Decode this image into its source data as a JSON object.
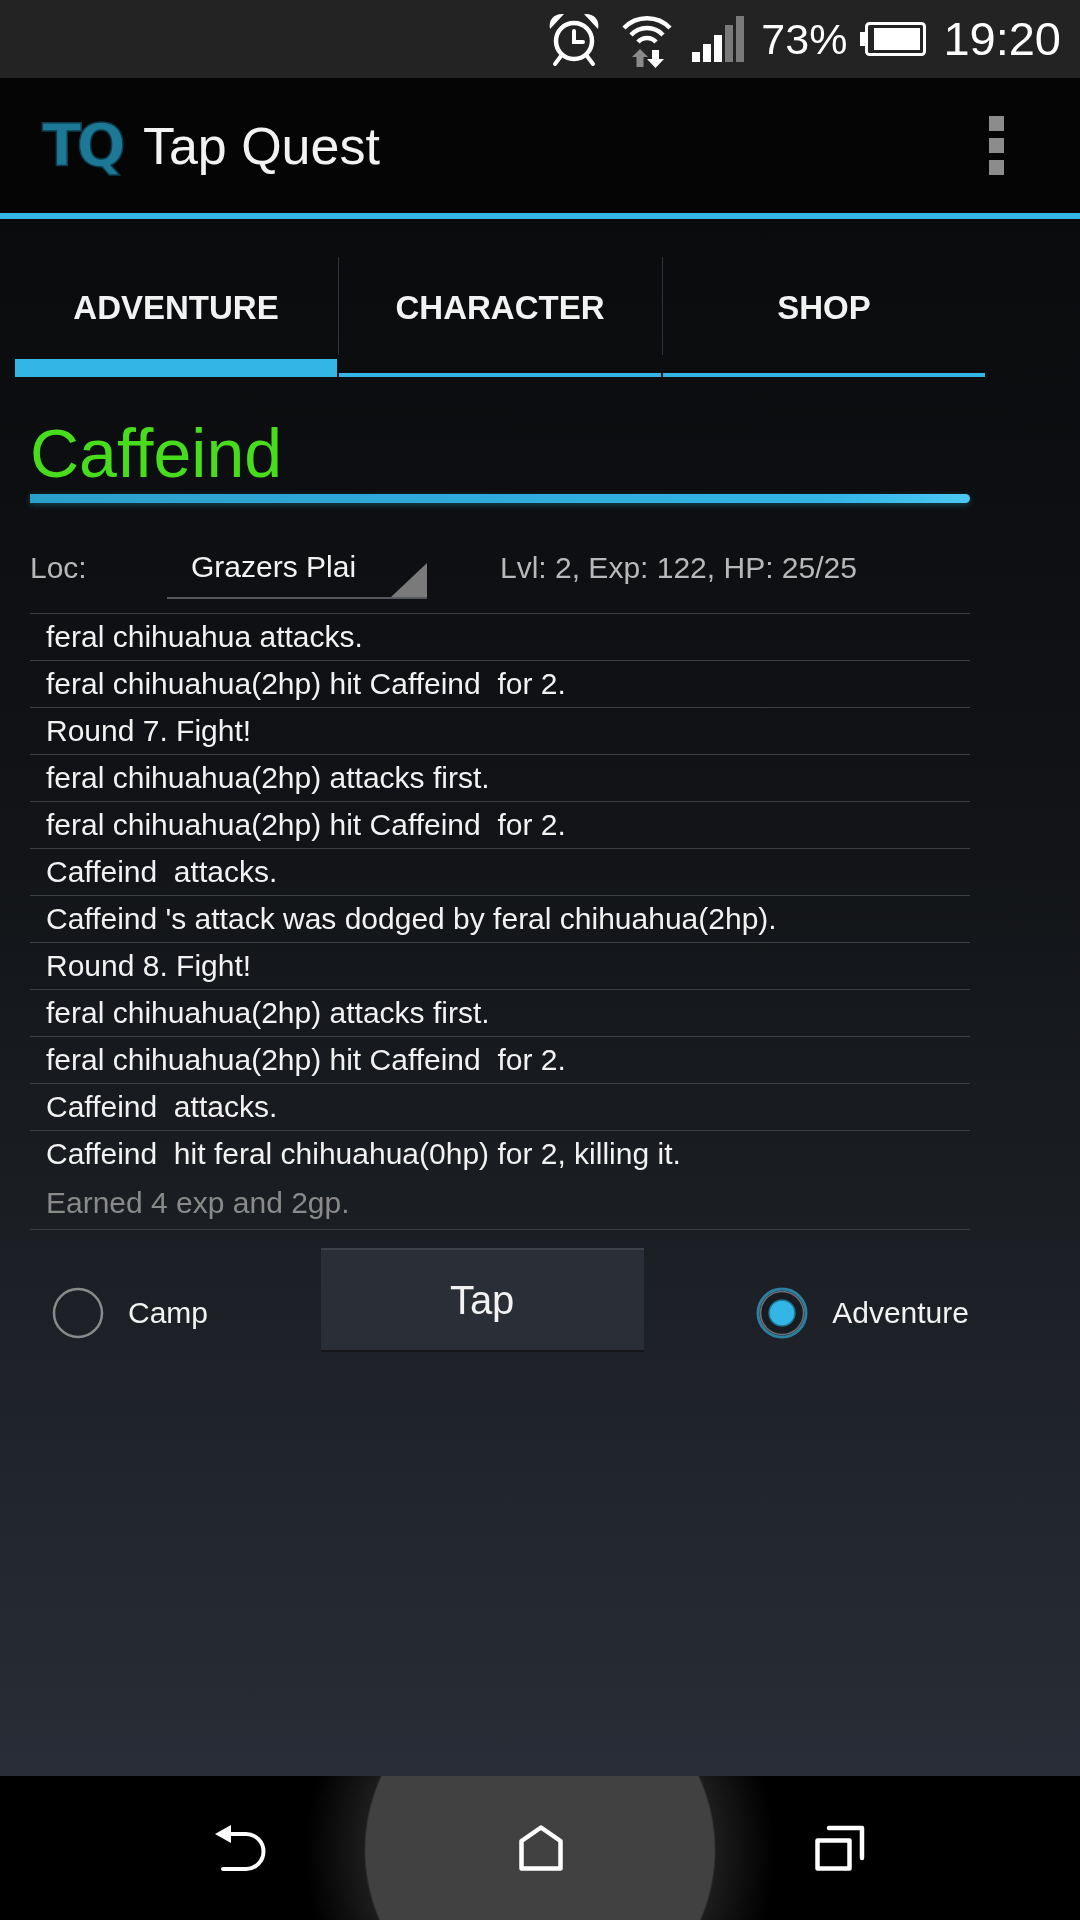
{
  "status_bar": {
    "battery": "73%",
    "time": "19:20"
  },
  "app_bar": {
    "logo": "TQ",
    "title": "Tap Quest"
  },
  "tabs": [
    {
      "label": "ADVENTURE",
      "selected": true
    },
    {
      "label": "CHARACTER",
      "selected": false
    },
    {
      "label": "SHOP",
      "selected": false
    }
  ],
  "character": {
    "name": "Caffeind"
  },
  "location": {
    "label": "Loc:",
    "value": "Grazers Plai",
    "stats": "Lvl: 2, Exp: 122, HP: 25/25"
  },
  "log": [
    {
      "kind": "event",
      "text": "feral chihuahua attacks."
    },
    {
      "kind": "event",
      "text": "feral chihuahua(2hp) hit Caffeind  for 2."
    },
    {
      "kind": "event",
      "text": "Round 7. Fight!"
    },
    {
      "kind": "event",
      "text": "feral chihuahua(2hp) attacks first."
    },
    {
      "kind": "event",
      "text": "feral chihuahua(2hp) hit Caffeind  for 2."
    },
    {
      "kind": "event",
      "text": "Caffeind  attacks."
    },
    {
      "kind": "event",
      "text": "Caffeind 's attack was dodged by feral chihuahua(2hp)."
    },
    {
      "kind": "event",
      "text": "Round 8. Fight!"
    },
    {
      "kind": "event",
      "text": "feral chihuahua(2hp) attacks first."
    },
    {
      "kind": "event",
      "text": "feral chihuahua(2hp) hit Caffeind  for 2."
    },
    {
      "kind": "event",
      "text": "Caffeind  attacks."
    },
    {
      "kind": "event",
      "text": "Caffeind  hit feral chihuahua(0hp) for 2, killing it."
    },
    {
      "kind": "note",
      "text": "Earned 4 exp and 2gp."
    }
  ],
  "controls": [
    {
      "kind": "radio",
      "label": "Camp",
      "selected": false
    },
    {
      "kind": "button",
      "label": "Tap"
    },
    {
      "kind": "radio",
      "label": "Adventure",
      "selected": true
    }
  ]
}
